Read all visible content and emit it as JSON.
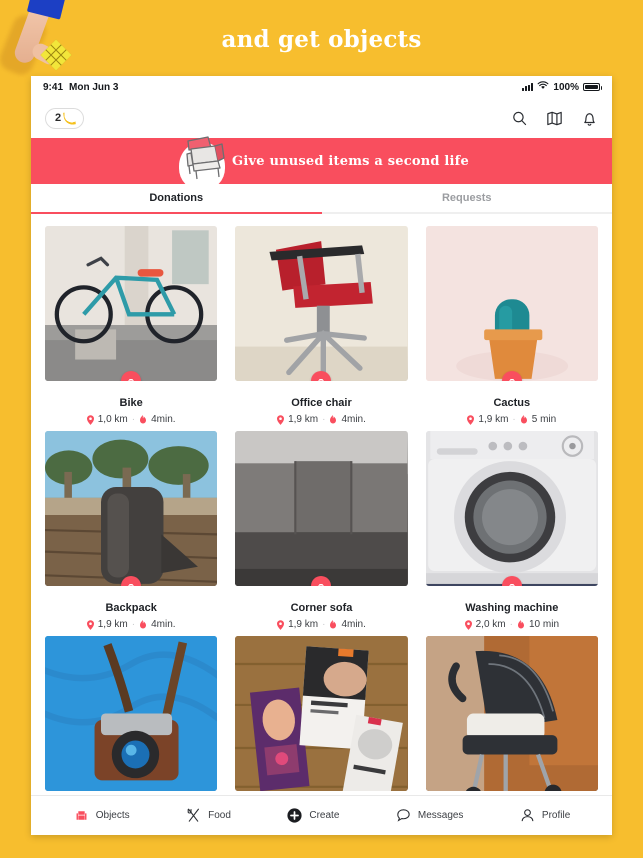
{
  "promo": {
    "headline": "and get objects",
    "background_color": "#F7BE2E",
    "accent_color": "#F94E5E"
  },
  "statusbar": {
    "time": "9:41",
    "date": "Mon Jun 3",
    "battery": "100%",
    "signal_icon": "cellular-signal-icon",
    "wifi_icon": "wifi-icon",
    "battery_icon": "battery-icon"
  },
  "appbar": {
    "coin_count": "2",
    "coin_icon": "banana-coin-icon",
    "icons": [
      {
        "name": "search-icon",
        "label": "Search"
      },
      {
        "name": "map-icon",
        "label": "Map"
      },
      {
        "name": "bell-icon",
        "label": "Notifications"
      }
    ]
  },
  "banner": {
    "text": "Give unused items a second life",
    "illustration": "armchair-illustration",
    "background_color": "#F94E5E"
  },
  "tabs": [
    {
      "label": "Donations",
      "active": true
    },
    {
      "label": "Requests",
      "active": false
    }
  ],
  "items": [
    {
      "title": "Bike",
      "distance": "1,0 km",
      "time": "4min.",
      "art": "img-bike",
      "badge": "chair-badge-icon"
    },
    {
      "title": "Office chair",
      "distance": "1,9 km",
      "time": "4min.",
      "art": "img-chair",
      "badge": "chair-badge-icon"
    },
    {
      "title": "Cactus",
      "distance": "1,9 km",
      "time": "5 min",
      "art": "img-cactus",
      "badge": "chair-badge-icon"
    },
    {
      "title": "Backpack",
      "distance": "1,9 km",
      "time": "4min.",
      "art": "img-backpack",
      "badge": "chair-badge-icon"
    },
    {
      "title": "Corner sofa",
      "distance": "1,9 km",
      "time": "4min.",
      "art": "img-sofa",
      "badge": "chair-badge-icon"
    },
    {
      "title": "Washing machine",
      "distance": "2,0 km",
      "time": "10 min",
      "art": "img-washer",
      "badge": "chair-badge-icon"
    },
    {
      "title": "",
      "distance": "",
      "time": "",
      "art": "img-camera",
      "badge": ""
    },
    {
      "title": "",
      "distance": "",
      "time": "",
      "art": "img-books",
      "badge": ""
    },
    {
      "title": "",
      "distance": "",
      "time": "",
      "art": "img-stroller",
      "badge": ""
    }
  ],
  "bottom_nav": [
    {
      "label": "Objects",
      "icon": "armchair-icon",
      "active": true
    },
    {
      "label": "Food",
      "icon": "cutlery-icon",
      "active": false
    },
    {
      "label": "Create",
      "icon": "plus-circle-icon",
      "active": false
    },
    {
      "label": "Messages",
      "icon": "chat-bubble-icon",
      "active": false
    },
    {
      "label": "Profile",
      "icon": "person-icon",
      "active": false
    }
  ]
}
